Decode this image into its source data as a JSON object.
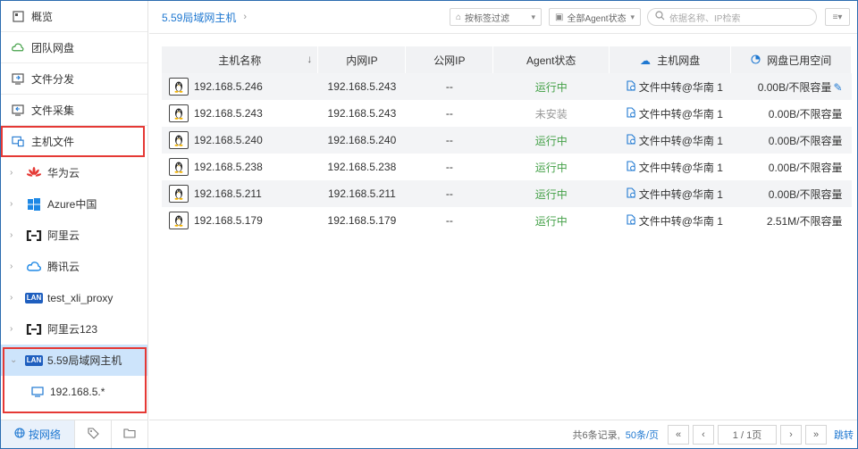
{
  "nav": {
    "items": [
      {
        "label": "概览",
        "icon": "overview-icon"
      },
      {
        "label": "团队网盘",
        "icon": "cloud-drive-icon"
      },
      {
        "label": "文件分发",
        "icon": "distribute-icon"
      },
      {
        "label": "文件采集",
        "icon": "collect-icon"
      },
      {
        "label": "主机文件",
        "icon": "host-files-icon"
      }
    ]
  },
  "tree": {
    "items": [
      {
        "label": "华为云",
        "icon": "huawei-icon"
      },
      {
        "label": "Azure中国",
        "icon": "windows-icon"
      },
      {
        "label": "阿里云",
        "icon": "aliyun-icon"
      },
      {
        "label": "腾讯云",
        "icon": "tencent-cloud-icon"
      },
      {
        "label": "test_xli_proxy",
        "icon": "lan-icon",
        "badge": "LAN"
      },
      {
        "label": "阿里云123",
        "icon": "aliyun-icon"
      }
    ],
    "selected": {
      "label": "5.59局域网主机",
      "badge": "LAN"
    },
    "sub": {
      "label": "192.168.5.*"
    }
  },
  "footer_tabs": {
    "network": "按网络"
  },
  "topbar": {
    "breadcrumb": "5.59局域网主机",
    "tag_filter": "按标签过滤",
    "agent_filter": "全部Agent状态",
    "search_placeholder": "依据名称、IP检索"
  },
  "table": {
    "headers": {
      "host": "主机名称",
      "sort": "↓",
      "lan_ip": "内网IP",
      "pub_ip": "公网IP",
      "agent": "Agent状态",
      "disk": "主机网盘",
      "space": "网盘已用空间"
    },
    "rows": [
      {
        "host": "192.168.5.246",
        "lan": "192.168.5.243",
        "pub": "--",
        "agent": "运行中",
        "disk": "文件中转@华南 1",
        "space": "0.00B/不限容量"
      },
      {
        "host": "192.168.5.243",
        "lan": "192.168.5.243",
        "pub": "--",
        "agent": "未安装",
        "disk": "文件中转@华南 1",
        "space": "0.00B/不限容量"
      },
      {
        "host": "192.168.5.240",
        "lan": "192.168.5.240",
        "pub": "--",
        "agent": "运行中",
        "disk": "文件中转@华南 1",
        "space": "0.00B/不限容量"
      },
      {
        "host": "192.168.5.238",
        "lan": "192.168.5.238",
        "pub": "--",
        "agent": "运行中",
        "disk": "文件中转@华南 1",
        "space": "0.00B/不限容量"
      },
      {
        "host": "192.168.5.211",
        "lan": "192.168.5.211",
        "pub": "--",
        "agent": "运行中",
        "disk": "文件中转@华南 1",
        "space": "0.00B/不限容量"
      },
      {
        "host": "192.168.5.179",
        "lan": "192.168.5.179",
        "pub": "--",
        "agent": "运行中",
        "disk": "文件中转@华南 1",
        "space": "2.51M/不限容量"
      }
    ]
  },
  "pager": {
    "total": "共6条记录,",
    "per_page": "50条/页",
    "first": "«",
    "prev": "‹",
    "page_info": "1 / 1页",
    "next": "›",
    "last": "»",
    "jump": "跳转"
  }
}
